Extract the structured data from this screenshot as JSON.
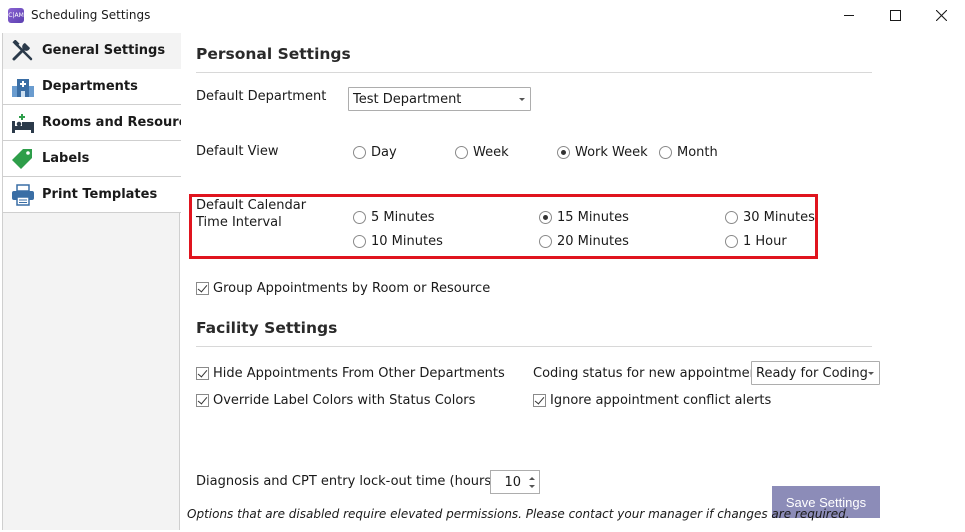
{
  "window": {
    "title": "Scheduling Settings",
    "app_icon_text": "C|AM"
  },
  "sidebar": {
    "items": [
      {
        "label": "General Settings",
        "icon": "tools-icon",
        "active": true
      },
      {
        "label": "Departments",
        "icon": "hospital-icon",
        "active": false
      },
      {
        "label": "Rooms and Resources",
        "icon": "bed-icon",
        "active": false
      },
      {
        "label": "Labels",
        "icon": "tag-icon",
        "active": false
      },
      {
        "label": "Print Templates",
        "icon": "printer-icon",
        "active": false
      }
    ]
  },
  "personal": {
    "title": "Personal Settings",
    "default_department_label": "Default Department",
    "default_department_value": "Test Department",
    "default_view_label": "Default View",
    "views": [
      {
        "label": "Day",
        "selected": false
      },
      {
        "label": "Week",
        "selected": false
      },
      {
        "label": "Work Week",
        "selected": true
      },
      {
        "label": "Month",
        "selected": false
      }
    ],
    "interval_label_line1": "Default Calendar",
    "interval_label_line2": "Time Interval",
    "intervals": [
      {
        "label": "5 Minutes",
        "selected": false
      },
      {
        "label": "15 Minutes",
        "selected": true
      },
      {
        "label": "30 Minutes",
        "selected": false
      },
      {
        "label": "10 Minutes",
        "selected": false
      },
      {
        "label": "20 Minutes",
        "selected": false
      },
      {
        "label": "1 Hour",
        "selected": false
      }
    ],
    "group_appointments_label": "Group Appointments by Room or Resource",
    "group_appointments_checked": true
  },
  "facility": {
    "title": "Facility Settings",
    "hide_appointments_label": "Hide Appointments From Other Departments",
    "hide_appointments_checked": true,
    "override_colors_label": "Override Label Colors with Status Colors",
    "override_colors_checked": true,
    "coding_status_label": "Coding status for new appointments",
    "coding_status_value": "Ready for Coding",
    "ignore_conflicts_label": "Ignore appointment conflict alerts",
    "ignore_conflicts_checked": true
  },
  "lockout": {
    "label": "Diagnosis and CPT entry lock-out time (hours)",
    "value": "10"
  },
  "footer": {
    "note": "Options that are disabled require elevated permissions.  Please contact your manager if changes are required.",
    "save_label": "Save Settings"
  },
  "colors": {
    "highlight": "#e0141e",
    "save_button": "#8c8cb8"
  }
}
